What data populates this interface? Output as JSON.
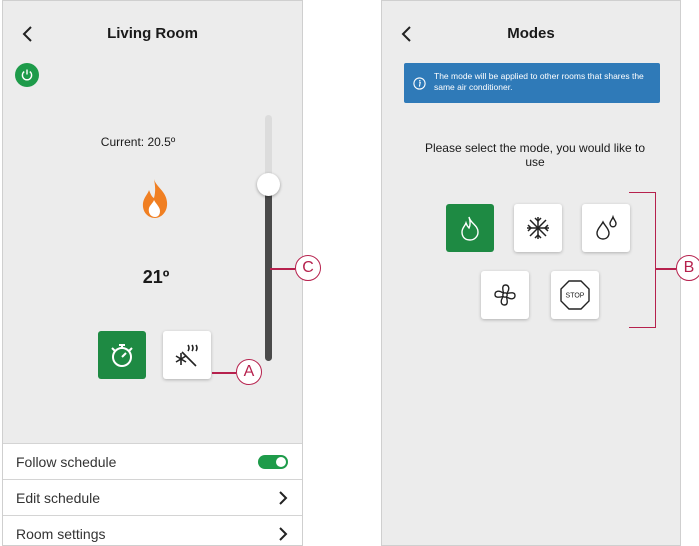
{
  "living_room": {
    "title": "Living Room",
    "current": "Current: 20.5º",
    "setpoint": "21º",
    "slider_level_percent": 72,
    "list": [
      {
        "label": "Follow schedule",
        "control": "toggle",
        "on": true
      },
      {
        "label": "Edit schedule",
        "control": "chevron"
      },
      {
        "label": "Room settings",
        "control": "chevron"
      }
    ]
  },
  "modes": {
    "title": "Modes",
    "info": "The mode will be applied to other rooms that shares the same air conditioner.",
    "prompt": "Please select the mode, you would like to use",
    "items": [
      {
        "icon": "flame-icon",
        "active": true
      },
      {
        "icon": "snowflake-icon",
        "active": false
      },
      {
        "icon": "droplets-icon",
        "active": false
      },
      {
        "icon": "fan-icon",
        "active": false
      },
      {
        "icon": "stop-icon",
        "label": "STOP",
        "active": false
      }
    ]
  },
  "callouts": {
    "a": "A",
    "b": "B",
    "c": "C"
  },
  "colors": {
    "accent_green": "#1e8a43",
    "info_blue": "#2f7ab8",
    "flame_orange": "#f07f22",
    "callout": "#b6214d"
  }
}
